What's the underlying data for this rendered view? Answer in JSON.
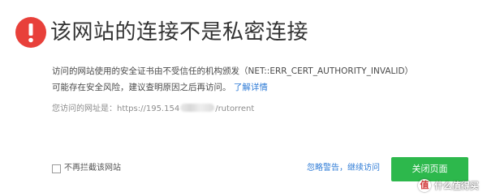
{
  "colors": {
    "warning_red": "#e8403a",
    "link_blue": "#2e7bd6",
    "button_green": "#2db84c"
  },
  "header": {
    "icon": "exclamation-icon",
    "title": "该网站的连接不是私密连接"
  },
  "message": {
    "line1": "访问的网站使用的安全证书由不受信任的机构颁发（NET::ERR_CERT_AUTHORITY_INVALID）",
    "line2": "可能存在安全风险，建议查明原因之后再访问。",
    "learn_more_link": "了解详情"
  },
  "url": {
    "prefix": "您访问的网址是：https://195.154",
    "suffix": "/rutorrent"
  },
  "footer": {
    "no_intercept_label": "不再拦截该网站",
    "no_intercept_checked": false,
    "ignore_link": "忽略警告，继续访问",
    "close_button": "关闭页面"
  },
  "watermark": {
    "text": "值 什么值得买",
    "logo_icon": "zhi-logo-icon"
  }
}
